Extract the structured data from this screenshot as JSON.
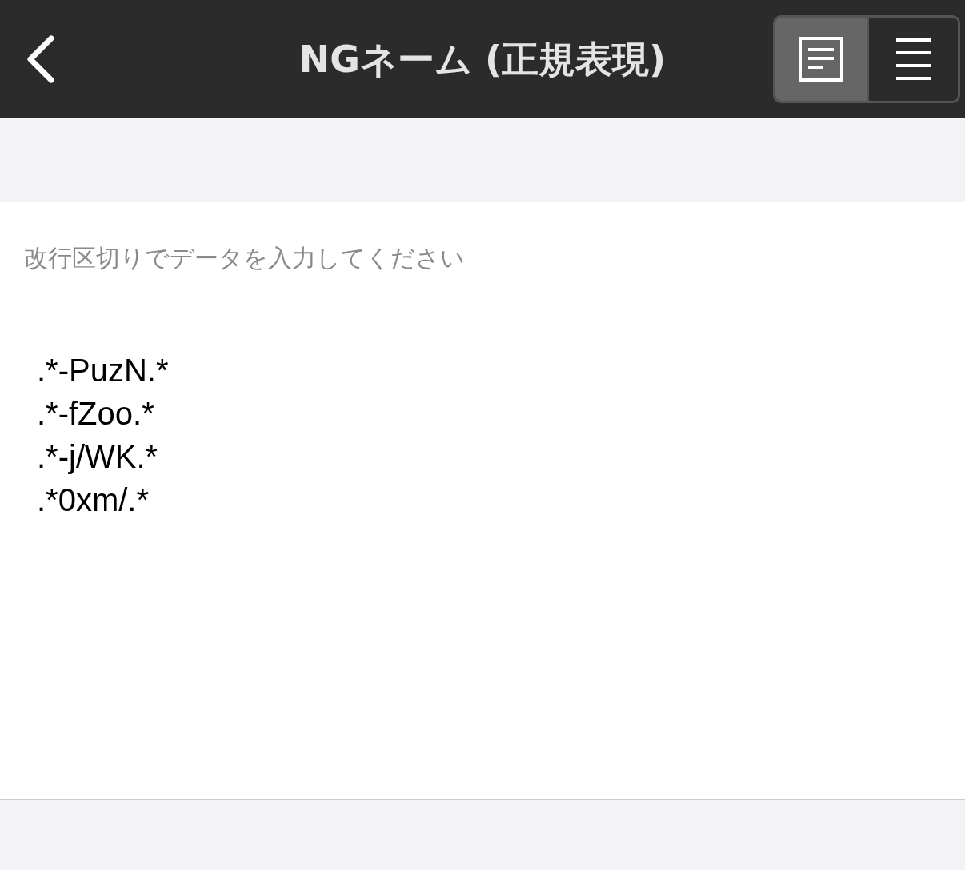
{
  "nav_bar": {
    "title": "NGネーム (正規表現)",
    "segments": [
      {
        "kind": "document",
        "selected": true
      },
      {
        "kind": "list",
        "selected": false
      }
    ]
  },
  "editor": {
    "hint": "改行区切りでデータを入力してください",
    "lines": [
      ".*-PuzN.*",
      ".*-fZoo.*",
      ".*-j/WK.*",
      ".*0xm/.*"
    ]
  }
}
